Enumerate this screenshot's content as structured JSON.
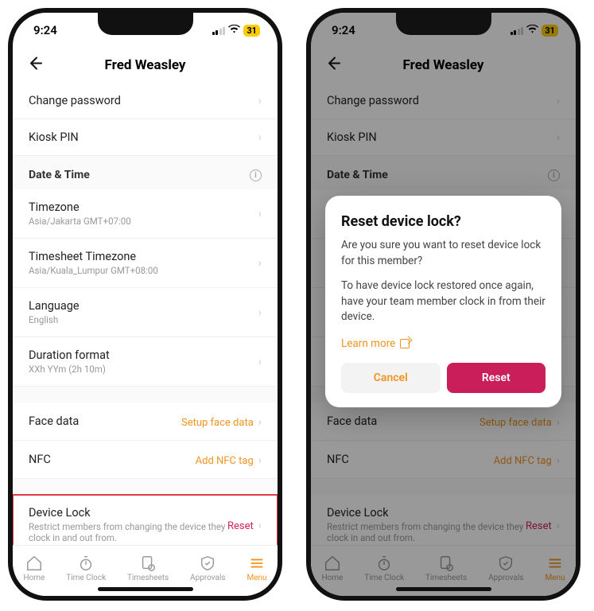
{
  "statusbar": {
    "time": "9:24",
    "battery_pct": "31"
  },
  "header": {
    "title": "Fred Weasley"
  },
  "rows": {
    "change_password": "Change password",
    "kiosk_pin": "Kiosk PIN"
  },
  "section_datetime": "Date & Time",
  "timezone": {
    "title": "Timezone",
    "sub": "Asia/Jakarta GMT+07:00"
  },
  "ts_timezone": {
    "title": "Timesheet Timezone",
    "sub": "Asia/Kuala_Lumpur GMT+08:00"
  },
  "language": {
    "title": "Language",
    "sub": "English"
  },
  "duration": {
    "title": "Duration format",
    "sub": "XXh YYm (2h 10m)"
  },
  "face_data": {
    "title": "Face data",
    "action": "Setup face data"
  },
  "nfc": {
    "title": "NFC",
    "action": "Add NFC tag"
  },
  "device_lock": {
    "title": "Device Lock",
    "sub": "Restrict members from changing the device they clock in and out from.",
    "action": "Reset"
  },
  "tabs": {
    "home": "Home",
    "timeclock": "Time Clock",
    "timesheets": "Timesheets",
    "approvals": "Approvals",
    "menu": "Menu"
  },
  "modal": {
    "title": "Reset device lock?",
    "body1": "Are you sure you want to reset device lock for this member?",
    "body2": "To have device lock restored once again, have your team member clock in from their device.",
    "learn": "Learn more",
    "cancel": "Cancel",
    "reset": "Reset"
  }
}
